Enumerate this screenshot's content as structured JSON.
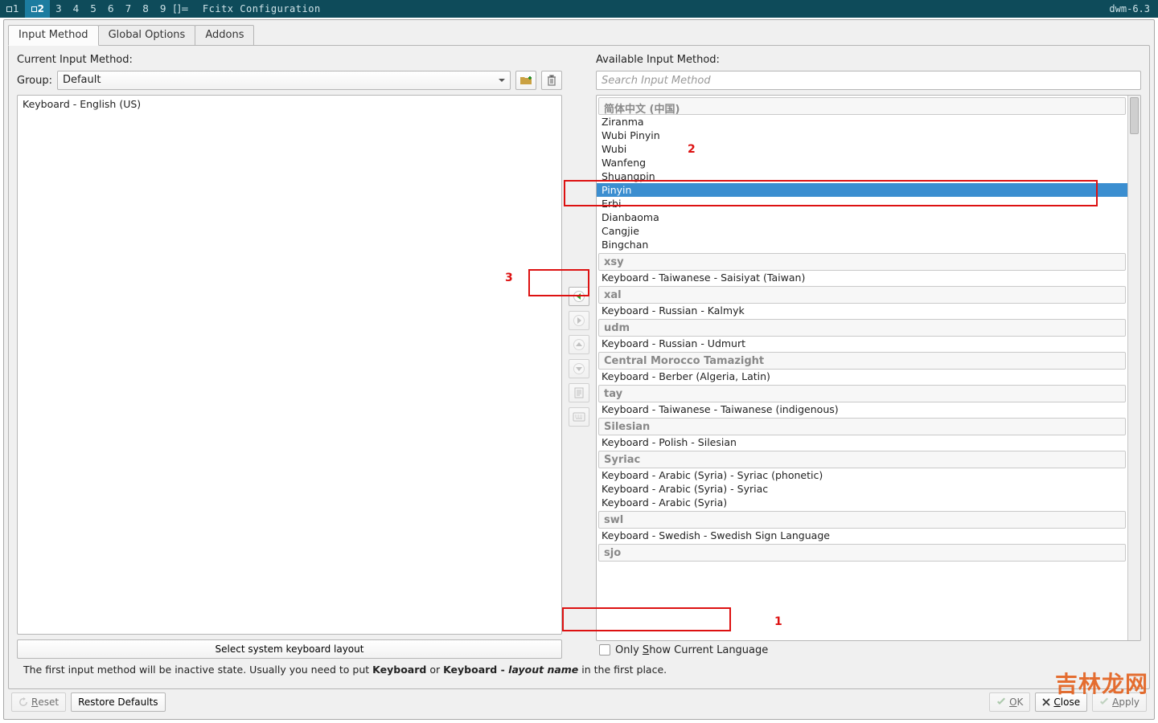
{
  "menubar": {
    "tags": [
      "1",
      "2",
      "3",
      "4",
      "5",
      "6",
      "7",
      "8",
      "9"
    ],
    "active_index": 1,
    "layout_indicator": "[]=",
    "title": "Fcitx Configuration",
    "right": "dwm-6.3"
  },
  "tabs": {
    "items": [
      "Input Method",
      "Global Options",
      "Addons"
    ],
    "active_index": 0
  },
  "left": {
    "title": "Current Input Method:",
    "group_label": "Group:",
    "group_value": "Default",
    "items": [
      "Keyboard - English (US)"
    ],
    "select_layout": "Select system keyboard layout"
  },
  "right": {
    "title": "Available Input Method:",
    "search_placeholder": "Search Input Method",
    "only_show_label": "Only Show Current Language",
    "groups": [
      {
        "header": "简体中文 (中国)",
        "items": [
          "Ziranma",
          "Wubi Pinyin",
          "Wubi",
          "Wanfeng",
          "Shuangpin",
          "Pinyin",
          "Erbi",
          "Dianbaoma",
          "Cangjie",
          "Bingchan"
        ],
        "selected": "Pinyin"
      },
      {
        "header": "xsy",
        "items": [
          "Keyboard - Taiwanese - Saisiyat (Taiwan)"
        ]
      },
      {
        "header": "xal",
        "items": [
          "Keyboard - Russian - Kalmyk"
        ]
      },
      {
        "header": "udm",
        "items": [
          "Keyboard - Russian - Udmurt"
        ]
      },
      {
        "header": "Central Morocco Tamazight",
        "items": [
          "Keyboard - Berber (Algeria, Latin)"
        ]
      },
      {
        "header": "tay",
        "items": [
          "Keyboard - Taiwanese - Taiwanese (indigenous)"
        ]
      },
      {
        "header": "Silesian",
        "items": [
          "Keyboard - Polish - Silesian"
        ]
      },
      {
        "header": "Syriac",
        "items": [
          "Keyboard - Arabic (Syria) - Syriac (phonetic)",
          "Keyboard - Arabic (Syria) - Syriac",
          "Keyboard - Arabic (Syria)"
        ]
      },
      {
        "header": "swl",
        "items": [
          "Keyboard - Swedish - Swedish Sign Language"
        ]
      },
      {
        "header": "sjo",
        "items": []
      }
    ]
  },
  "hint": {
    "pre": "The first input method will be inactive state. Usually you need to put ",
    "b1": "Keyboard",
    "mid": " or ",
    "b2": "Keyboard - ",
    "bi": "layout name",
    "post": " in the first place."
  },
  "footer": {
    "reset": "Reset",
    "restore": "Restore Defaults",
    "ok": "OK",
    "close": "Close",
    "apply": "Apply"
  },
  "annotations": {
    "n1": "1",
    "n2": "2",
    "n3": "3",
    "watermark": "吉林龙网"
  }
}
